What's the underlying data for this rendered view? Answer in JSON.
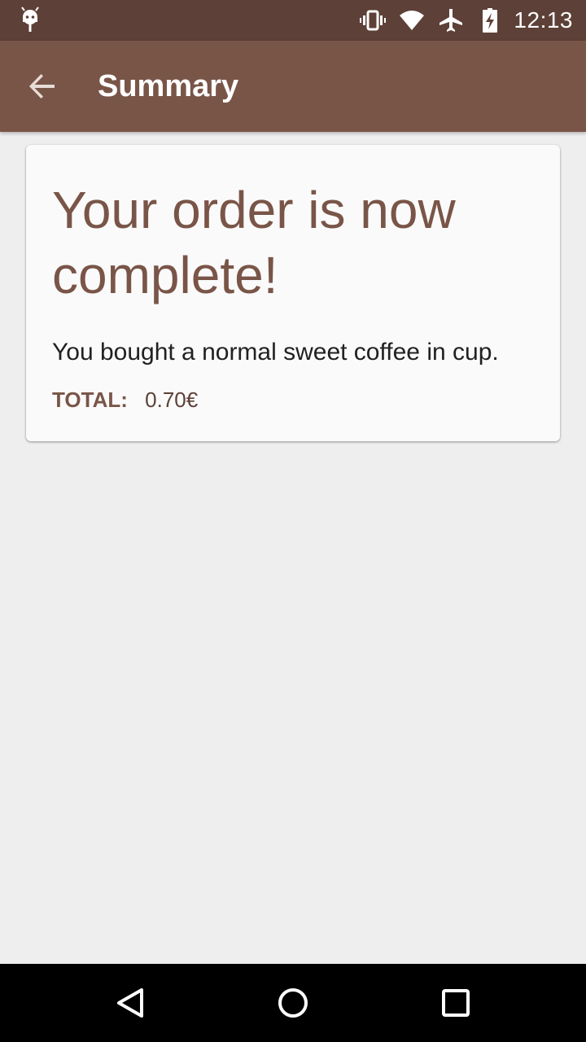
{
  "status_bar": {
    "time": "12:13",
    "left_icon": "android-debug-icon",
    "icons": [
      "vibrate-icon",
      "wifi-icon",
      "airplane-mode-icon",
      "battery-charging-icon"
    ]
  },
  "app_bar": {
    "back_icon": "arrow-back-icon",
    "title": "Summary"
  },
  "order_card": {
    "headline": "Your order is now complete!",
    "message": "You bought a normal sweet coffee in cup.",
    "total_label": "TOTAL:",
    "total_value": "0.70€"
  },
  "nav_bar": {
    "buttons": [
      "back-triangle-icon",
      "home-circle-icon",
      "recents-square-icon"
    ]
  },
  "colors": {
    "status_bar": "#5d4037",
    "app_bar": "#795548",
    "background": "#eeeeee",
    "card": "#fafafa",
    "accent_text": "#795548"
  }
}
